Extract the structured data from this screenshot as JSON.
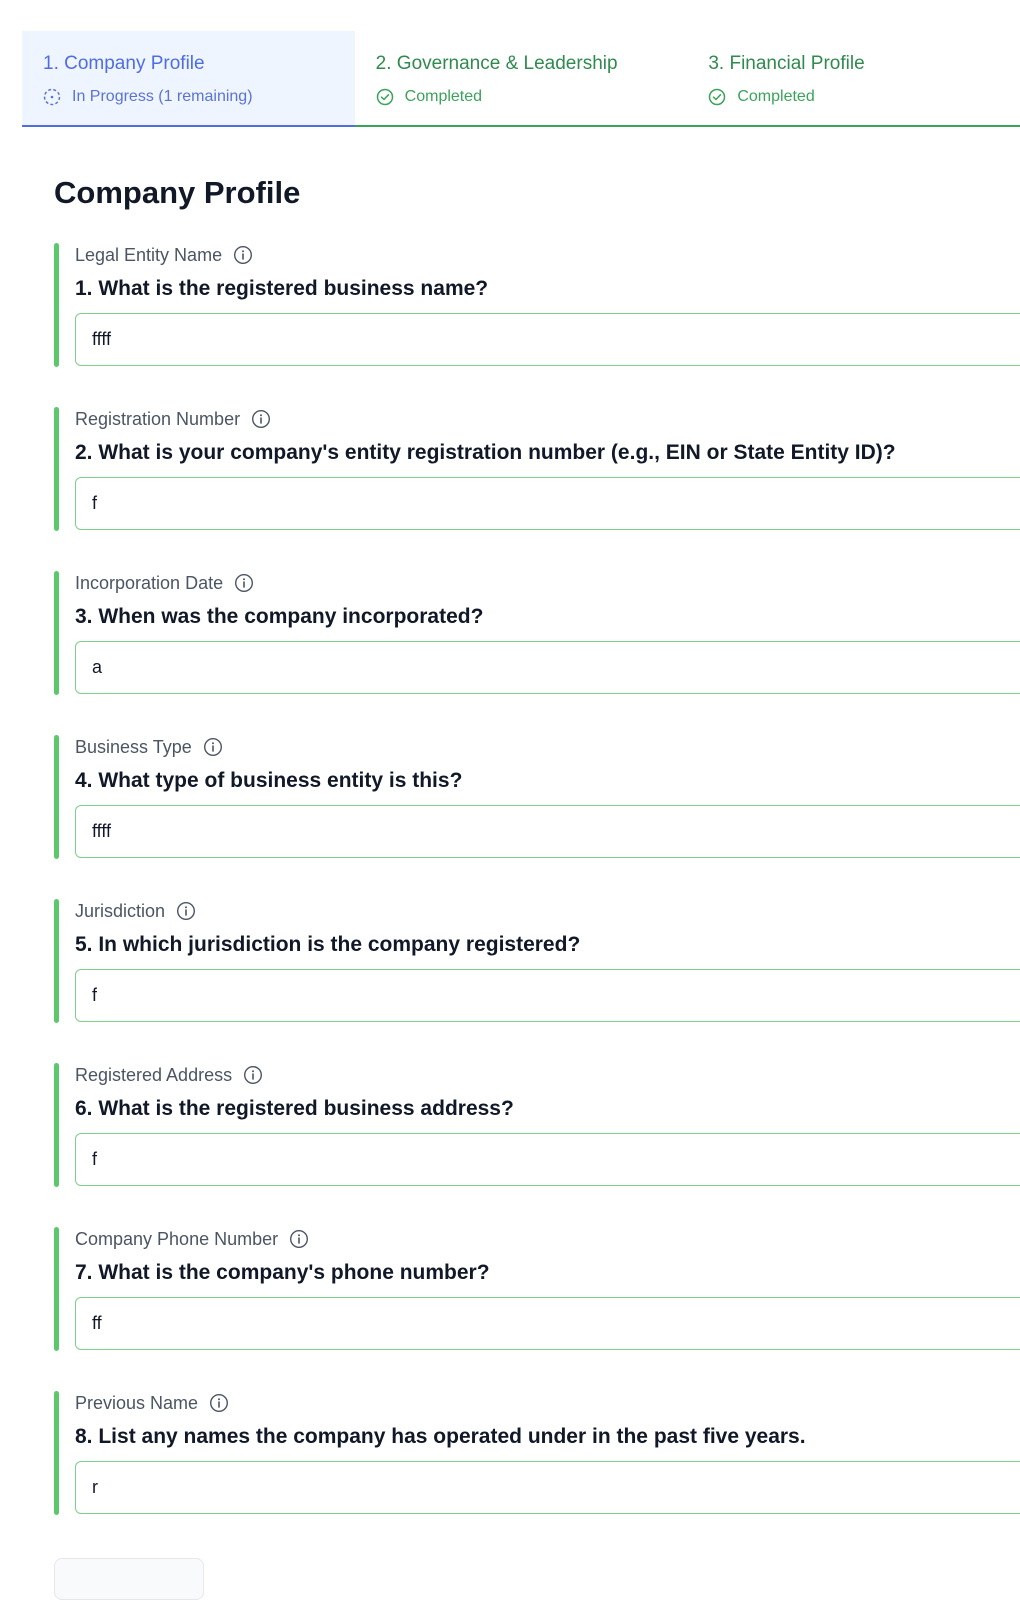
{
  "tabs": [
    {
      "title": "1. Company Profile",
      "status": "In Progress (1 remaining)",
      "state": "in-progress"
    },
    {
      "title": "2. Governance & Leadership",
      "status": "Completed",
      "state": "completed"
    },
    {
      "title": "3. Financial Profile",
      "status": "Completed",
      "state": "completed"
    }
  ],
  "section": {
    "title": "Company Profile"
  },
  "questions": [
    {
      "label": "Legal Entity Name",
      "text": "1. What is the registered business name?",
      "value": "ffff"
    },
    {
      "label": "Registration Number",
      "text": "2. What is your company's entity registration number (e.g., EIN or State Entity ID)?",
      "value": "f"
    },
    {
      "label": "Incorporation Date",
      "text": "3. When was the company incorporated?",
      "value": "a"
    },
    {
      "label": "Business Type",
      "text": "4. What type of business entity is this?",
      "value": "ffff"
    },
    {
      "label": "Jurisdiction",
      "text": "5. In which jurisdiction is the company registered?",
      "value": "f"
    },
    {
      "label": "Registered Address",
      "text": "6. What is the registered business address?",
      "value": "f"
    },
    {
      "label": "Company Phone Number",
      "text": "7. What is the company's phone number?",
      "value": "ff"
    },
    {
      "label": "Previous Name",
      "text": "8. List any names the company has operated under in the past five years.",
      "value": "r"
    }
  ],
  "icons": {
    "in_progress": "dashed-circle-icon",
    "completed": "check-circle-icon",
    "info": "info-icon"
  },
  "colors": {
    "active_tab_bg": "#eef5ff",
    "active_accent": "#4f6de0",
    "complete_green": "#3aa35a",
    "question_bar": "#5cc86b",
    "input_border": "#7dd08a"
  }
}
